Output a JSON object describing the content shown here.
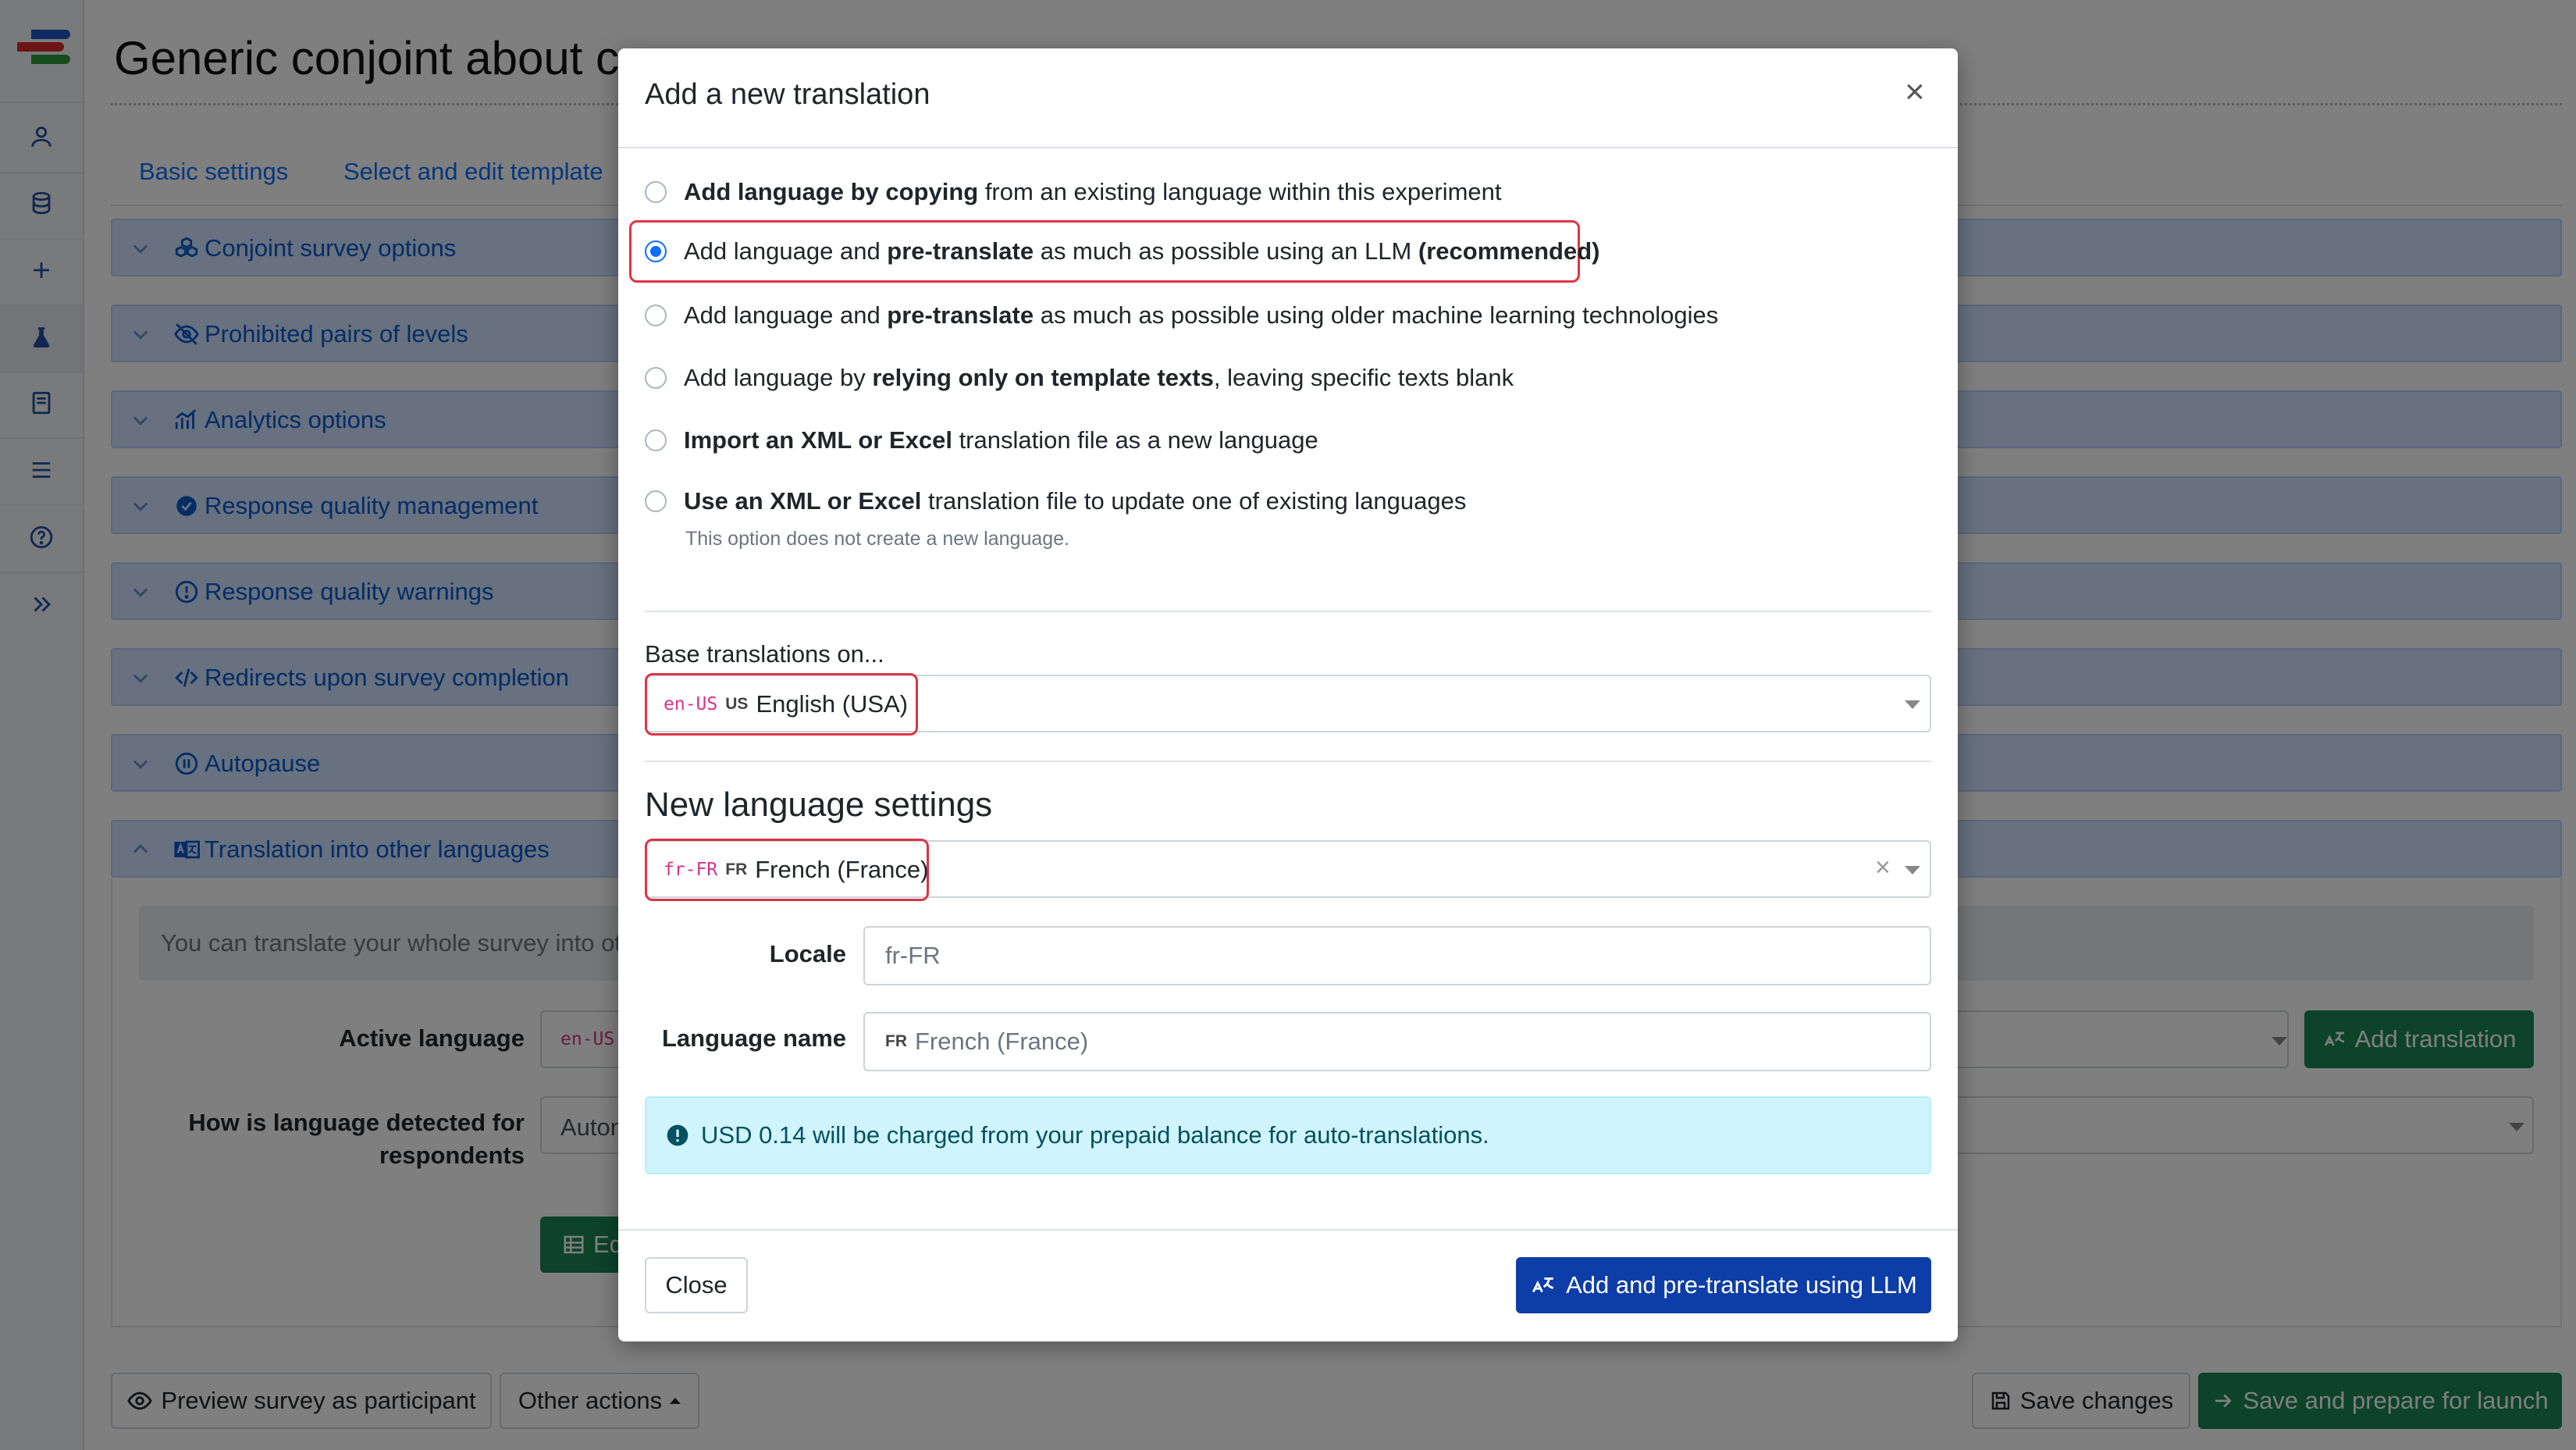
{
  "page": {
    "title": "Generic conjoint about c",
    "tabs": [
      "Basic settings",
      "Select and edit template"
    ]
  },
  "accordion": [
    {
      "label": "Conjoint survey options",
      "icon": "cubes-icon"
    },
    {
      "label": "Prohibited pairs of levels",
      "icon": "eye-slash-icon"
    },
    {
      "label": "Analytics options",
      "icon": "analytics-icon"
    },
    {
      "label": "Response quality management",
      "icon": "check-circle-icon"
    },
    {
      "label": "Response quality warnings",
      "icon": "exclamation-circle-icon"
    },
    {
      "label": "Redirects upon survey completion",
      "icon": "code-icon"
    },
    {
      "label": "Autopause",
      "icon": "pause-circle-icon"
    },
    {
      "label": "Translation into other languages",
      "icon": "translate-icon"
    }
  ],
  "translation_section": {
    "info_text": "You can translate your whole survey into oth",
    "active_language_label": "Active language",
    "active_language_code": "en-US",
    "add_translation_label": "Add translation",
    "detect_label_line1": "How is language detected for",
    "detect_label_line2": "respondents",
    "detect_value": "Auton",
    "edit_button_label": "Ed"
  },
  "bottom_bar": {
    "preview_label": "Preview survey as participant",
    "other_actions_label": "Other actions",
    "save_label": "Save changes",
    "save_launch_label": "Save and prepare for launch"
  },
  "modal": {
    "title": "Add a new translation",
    "close_symbol": "×",
    "options": [
      {
        "bold1": "Add language by copying",
        "rest": " from an existing language within this experiment"
      },
      {
        "pre": "Add language and ",
        "bold1": "pre-translate",
        "rest": " as much as possible using an LLM ",
        "bold2": "(recommended)",
        "checked": true
      },
      {
        "pre": "Add language and ",
        "bold1": "pre-translate",
        "rest": " as much as possible using older machine learning technologies"
      },
      {
        "pre": "Add language by ",
        "bold1": "relying only on template texts",
        "rest": ", leaving specific texts blank"
      },
      {
        "bold1": "Import an XML or Excel",
        "rest": " translation file as a new language"
      },
      {
        "bold1": "Use an XML or Excel",
        "rest": " translation file to update one of existing languages"
      }
    ],
    "option_hint": "This option does not create a new language.",
    "base_label": "Base translations on...",
    "base_code": "en-US",
    "base_flag": "US",
    "base_name": "English (USA)",
    "new_lang_heading": "New language settings",
    "new_code": "fr-FR",
    "new_flag": "FR",
    "new_name": "French (France)",
    "clear_symbol": "×",
    "locale_label": "Locale",
    "locale_value": "fr-FR",
    "langname_label": "Language name",
    "langname_flag": "FR",
    "langname_value": "French (France)",
    "charge_text": "USD 0.14 will be charged from your prepaid balance for auto-translations.",
    "close_button": "Close",
    "submit_button": "Add and pre-translate using LLM"
  }
}
